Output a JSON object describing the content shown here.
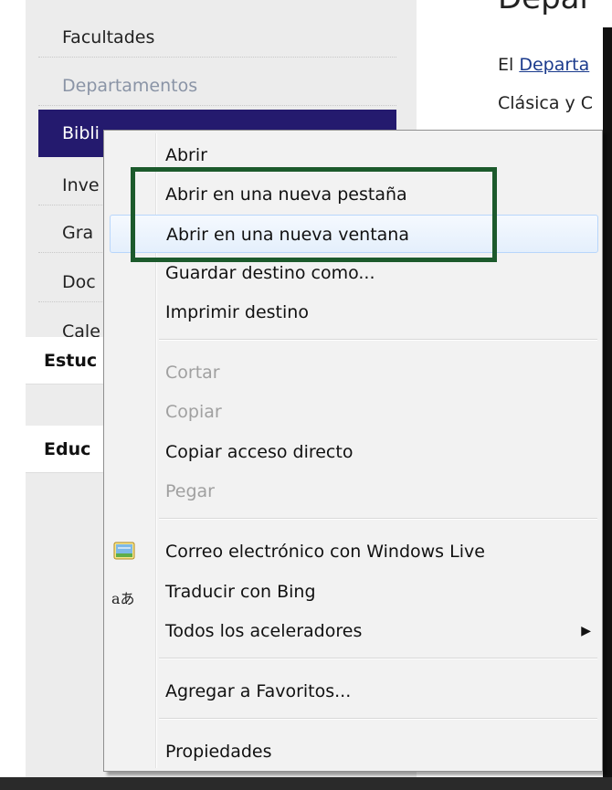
{
  "sidebar": {
    "items": [
      {
        "label": "Facultades",
        "state": "normal"
      },
      {
        "label": "Departamentos",
        "state": "muted"
      },
      {
        "label": "Bibli",
        "state": "active"
      },
      {
        "label": "Inve",
        "state": "normal"
      },
      {
        "label": "Gra",
        "state": "normal"
      },
      {
        "label": "Doc",
        "state": "normal"
      },
      {
        "label": "Cale",
        "state": "normal"
      }
    ],
    "sections": [
      {
        "label": "Estuc"
      },
      {
        "label": "Educ"
      }
    ]
  },
  "content": {
    "heading": "Depar",
    "line1_prefix": "El ",
    "line1_link": "Departa",
    "line2": "Clásica y C"
  },
  "context_menu": {
    "items": [
      {
        "label": "Abrir"
      },
      {
        "label": "Abrir en una nueva pestaña"
      },
      {
        "label": "Abrir en una nueva ventana",
        "hover": true
      },
      {
        "label": "Guardar destino como..."
      },
      {
        "label": "Imprimir destino"
      },
      {
        "label": "Cortar",
        "disabled": true
      },
      {
        "label": "Copiar",
        "disabled": true
      },
      {
        "label": "Copiar acceso directo"
      },
      {
        "label": "Pegar",
        "disabled": true
      },
      {
        "label": "Correo electrónico con Windows Live",
        "icon": "mail-icon"
      },
      {
        "label": "Traducir con Bing",
        "icon": "translate-icon"
      },
      {
        "label": "Todos los aceleradores",
        "submenu": true
      },
      {
        "label": "Agregar a Favoritos..."
      },
      {
        "label": "Propiedades"
      }
    ],
    "submenu_arrow": "▶",
    "translate_glyph": "aあ"
  },
  "colors": {
    "active_nav": "#241a6e",
    "highlight_border": "#1c5a2c",
    "hover_border": "#b8d6fb"
  }
}
